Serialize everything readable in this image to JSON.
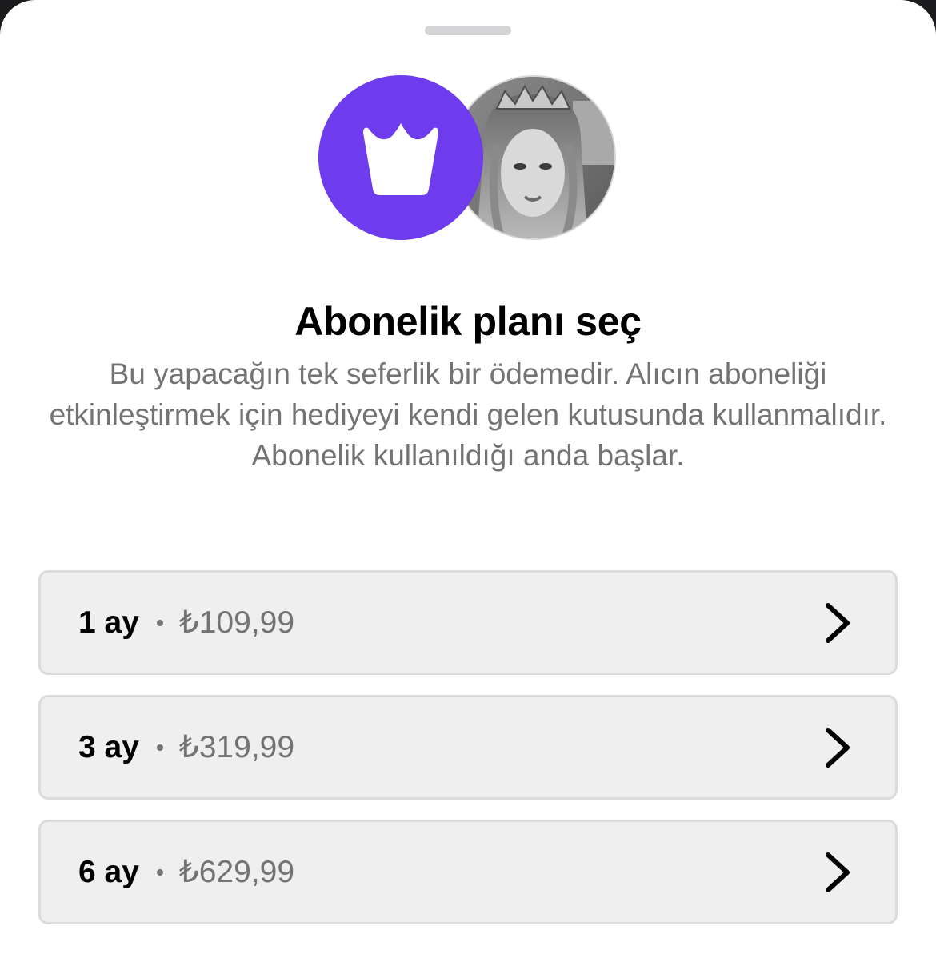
{
  "sheet": {
    "grabber": "drag-handle"
  },
  "header": {
    "badge_icon": "crown-icon",
    "badge_color": "#6e3ced",
    "avatar_icon": "profile-photo"
  },
  "title": "Abonelik planı seç",
  "description": "Bu yapacağın tek seferlik bir ödemedir. Alıcın aboneliği etkinleştirmek için hediyeyi kendi gelen kutusunda kullanmalıdır. Abonelik kullanıldığı anda başlar.",
  "plans": [
    {
      "duration": "1 ay",
      "price": "₺109,99",
      "icon": "chevron-right-icon"
    },
    {
      "duration": "3 ay",
      "price": "₺319,99",
      "icon": "chevron-right-icon"
    },
    {
      "duration": "6 ay",
      "price": "₺629,99",
      "icon": "chevron-right-icon"
    }
  ],
  "colors": {
    "accent": "#6e3ced",
    "plan_background": "#efefef",
    "plan_border": "#dbdbdb",
    "secondary_text": "#737373"
  }
}
